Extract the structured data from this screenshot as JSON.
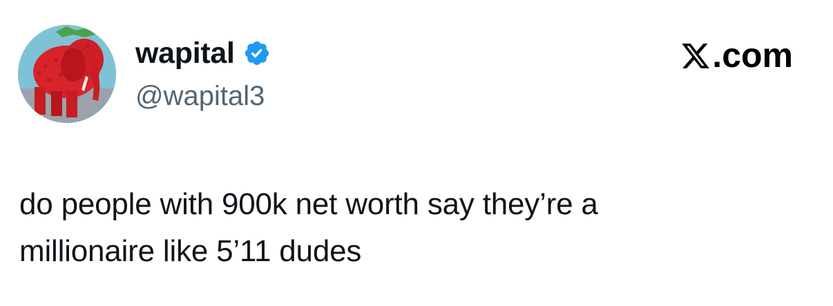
{
  "author": {
    "display_name": "wapital",
    "handle": "@wapital3",
    "verified": true,
    "verified_icon": "verified-badge-icon",
    "avatar_icon": "red-elephant-avatar"
  },
  "site": {
    "label": ".com",
    "logo_icon": "x-logo-icon"
  },
  "tweet": {
    "text": "do people with 900k net worth say they’re a\nmillionaire like 5’11 dudes"
  },
  "colors": {
    "text": "#0f1419",
    "handle": "#536471",
    "verified": "#1d9bf0",
    "avatar_body": "#d8232a"
  }
}
